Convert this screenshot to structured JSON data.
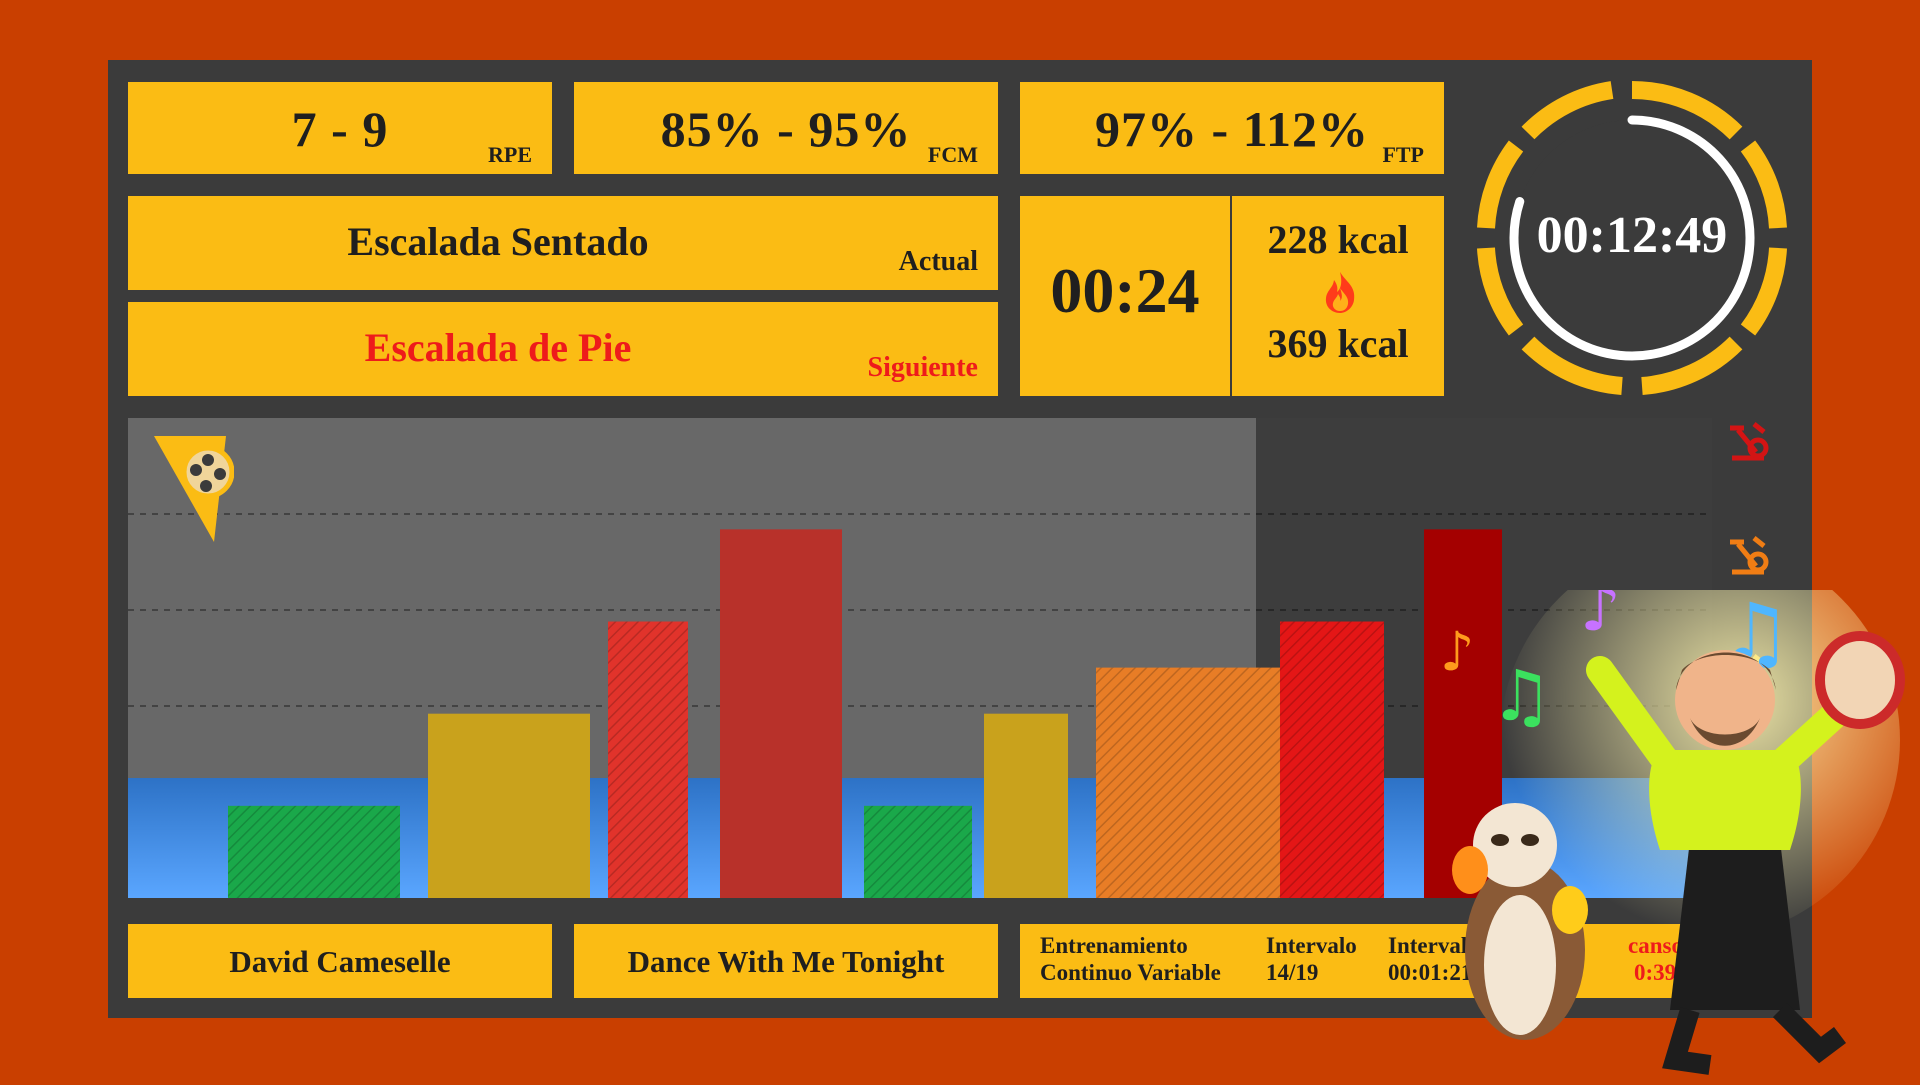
{
  "metrics": {
    "rpe": {
      "value": "7 - 9",
      "unit": "RPE"
    },
    "fcm": {
      "value": "85% - 95%",
      "unit": "FCM"
    },
    "ftp": {
      "value": "97% - 112%",
      "unit": "FTP"
    }
  },
  "phase": {
    "current": {
      "name": "Escalada Sentado",
      "tag": "Actual"
    },
    "next": {
      "name": "Escalada de Pie",
      "tag": "Siguiente"
    }
  },
  "segment_timer": "00:24",
  "calories": {
    "current": "228 kcal",
    "total": "369 kcal"
  },
  "clock": {
    "time": "00:12:49",
    "progress": 0.8
  },
  "footer": {
    "instructor": "David Cameselle",
    "song": "Dance With Me Tonight",
    "training_label_1": "Entrenamiento",
    "training_label_2": "Continuo Variable",
    "interval_label": "Intervalo",
    "interval_value": "14/19",
    "interval_avg_label": "Intervalo Med",
    "interval_avg_value": "00:01:21",
    "rest_label": "canso",
    "rest_value": "0:39"
  },
  "icons": {
    "logo": "cinema-slice-logo-icon",
    "bike_red": "stationary-bike-icon",
    "bike_orange": "stationary-bike-icon",
    "bike_yellow": "stationary-bike-icon",
    "fire": "fire-icon"
  },
  "colors": {
    "background": "#c93f00",
    "panel": "#3b3b3b",
    "box": "#fbbc14",
    "next_text": "#ee1b1b",
    "water": "#3f8ee3"
  },
  "chart_data": {
    "type": "bar",
    "y_range": [
      0,
      5
    ],
    "intervals": [
      {
        "level": 1,
        "duration": 0.2,
        "color": "#1aa84a",
        "style": "hatched"
      },
      {
        "level": 2,
        "duration": 0.2,
        "color": "#c9a21c",
        "style": "solid"
      },
      {
        "level": 3,
        "duration": 0.12,
        "color": "#e1332b",
        "style": "hatched"
      },
      {
        "level": 4,
        "duration": 0.2,
        "color": "#b8312a",
        "style": "solid"
      },
      {
        "level": 1,
        "duration": 0.15,
        "color": "#1aa84a",
        "style": "hatched"
      },
      {
        "level": 2,
        "duration": 0.12,
        "color": "#c9a21c",
        "style": "solid"
      },
      {
        "level": 2.5,
        "duration": 0.28,
        "color": "#e87d26",
        "style": "hatched"
      },
      {
        "level": 3,
        "duration": 0.15,
        "color": "#e41616",
        "style": "hatched"
      },
      {
        "level": 4,
        "duration": 0.12,
        "color": "#a40000",
        "style": "solid"
      }
    ]
  }
}
